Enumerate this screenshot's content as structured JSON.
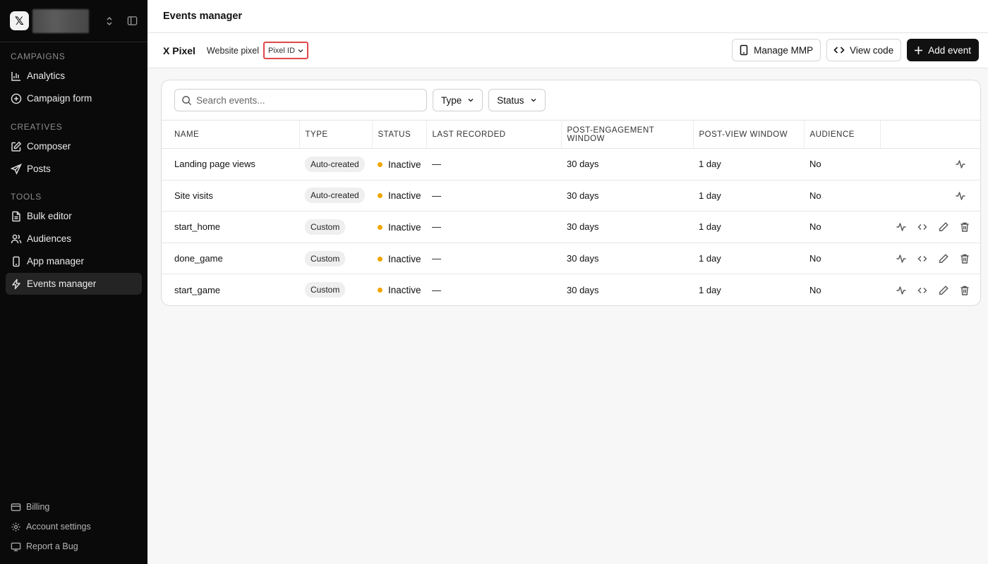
{
  "sidebar": {
    "logo_glyph": "𝕏",
    "sections": [
      {
        "title": "CAMPAIGNS",
        "items": [
          {
            "label": "Analytics",
            "icon": "bar-chart-icon"
          },
          {
            "label": "Campaign form",
            "icon": "plus-circle-icon"
          }
        ]
      },
      {
        "title": "CREATIVES",
        "items": [
          {
            "label": "Composer",
            "icon": "compose-icon"
          },
          {
            "label": "Posts",
            "icon": "send-icon"
          }
        ]
      },
      {
        "title": "TOOLS",
        "items": [
          {
            "label": "Bulk editor",
            "icon": "document-icon"
          },
          {
            "label": "Audiences",
            "icon": "users-icon"
          },
          {
            "label": "App manager",
            "icon": "phone-icon"
          },
          {
            "label": "Events manager",
            "icon": "lightning-icon",
            "active": true
          }
        ]
      }
    ],
    "footer": [
      {
        "label": "Billing",
        "icon": "card-icon"
      },
      {
        "label": "Account settings",
        "icon": "gear-icon"
      },
      {
        "label": "Report a Bug",
        "icon": "bug-icon"
      }
    ]
  },
  "header": {
    "title": "Events manager"
  },
  "pixel": {
    "title": "X Pixel",
    "type_label": "Website pixel",
    "id_dropdown": "Pixel ID"
  },
  "toolbar": {
    "manage_mmp": "Manage MMP",
    "view_code": "View code",
    "add_event": "Add event"
  },
  "filters": {
    "search_placeholder": "Search events...",
    "type": "Type",
    "status": "Status"
  },
  "table": {
    "columns": [
      "NAME",
      "TYPE",
      "STATUS",
      "LAST RECORDED",
      "POST-ENGAGEMENT WINDOW",
      "POST-VIEW WINDOW",
      "AUDIENCE",
      ""
    ],
    "rows": [
      {
        "name": "Landing page views",
        "type": "Auto-created",
        "status": "Inactive",
        "last_recorded": "—",
        "engagement": "30 days",
        "view": "1 day",
        "audience": "No",
        "editable": false
      },
      {
        "name": "Site visits",
        "type": "Auto-created",
        "status": "Inactive",
        "last_recorded": "—",
        "engagement": "30 days",
        "view": "1 day",
        "audience": "No",
        "editable": false
      },
      {
        "name": "start_home",
        "type": "Custom",
        "status": "Inactive",
        "last_recorded": "—",
        "engagement": "30 days",
        "view": "1 day",
        "audience": "No",
        "editable": true
      },
      {
        "name": "done_game",
        "type": "Custom",
        "status": "Inactive",
        "last_recorded": "—",
        "engagement": "30 days",
        "view": "1 day",
        "audience": "No",
        "editable": true
      },
      {
        "name": "start_game",
        "type": "Custom",
        "status": "Inactive",
        "last_recorded": "—",
        "engagement": "30 days",
        "view": "1 day",
        "audience": "No",
        "editable": true
      }
    ]
  },
  "colors": {
    "status_inactive": "#f0a500",
    "highlight_border": "#e0474c",
    "primary_button": "#111111"
  }
}
